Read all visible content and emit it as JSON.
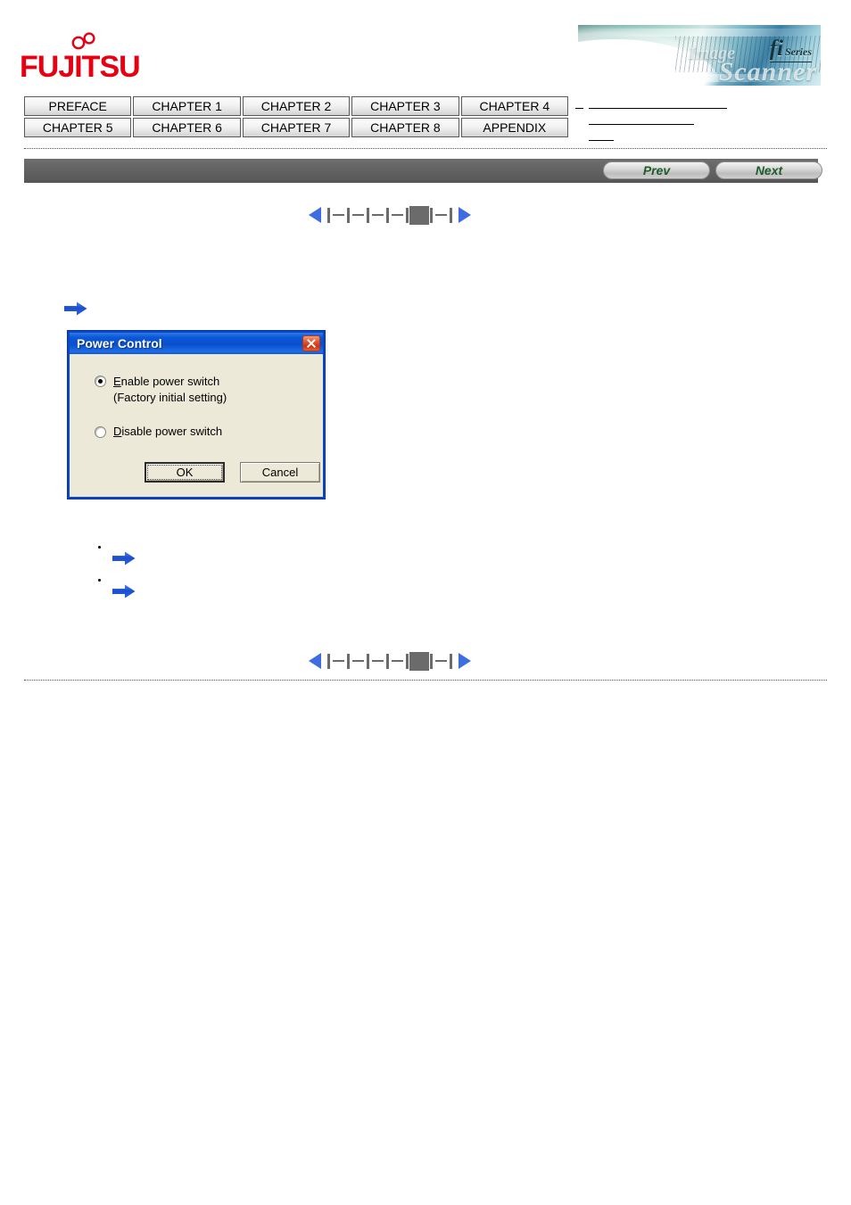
{
  "header": {
    "logo_text": "FUJITSU",
    "logo_color": "#e60012",
    "banner": {
      "product_line": "fi",
      "series_label": "Series",
      "tagline_primary": "Image",
      "tagline_secondary": "Scanner"
    }
  },
  "chapter_nav": {
    "row1": [
      "PREFACE",
      "CHAPTER 1",
      "CHAPTER 2",
      "CHAPTER 3",
      "CHAPTER 4"
    ],
    "row2": [
      "CHAPTER 5",
      "CHAPTER 6",
      "CHAPTER 7",
      "CHAPTER 8",
      "APPENDIX"
    ]
  },
  "toolbar": {
    "prev_label": "Prev",
    "next_label": "Next",
    "bar_color": "#616161",
    "button_text_color": "#1d5c2a"
  },
  "page_indicator": {
    "prev_icon": "triangle-left-icon",
    "next_icon": "triangle-right-icon",
    "total_ticks": 7,
    "current_tick": 5,
    "accent_color": "#3d6de0",
    "tick_color": "#6b6b6b"
  },
  "dialog": {
    "title": "Power Control",
    "close_icon": "close-icon",
    "titlebar_color": "#0b4fcd",
    "body_color": "#ece9d8",
    "options": [
      {
        "label": "Enable power switch",
        "accelerator": "E",
        "sublabel": "(Factory initial setting)",
        "sublabel_accelerator": "g",
        "selected": true
      },
      {
        "label": "Disable power switch",
        "accelerator": "D",
        "sublabel": "",
        "selected": false
      }
    ],
    "buttons": {
      "ok_label": "OK",
      "cancel_label": "Cancel",
      "default_button": "OK"
    }
  },
  "content": {
    "intro_arrow_icon": "blue-arrow-icon",
    "bullets": [
      {
        "marker": "bullet-dot",
        "arrow_icon": "blue-arrow-icon"
      },
      {
        "marker": "bullet-dot",
        "arrow_icon": "blue-arrow-icon"
      }
    ]
  },
  "breadcrumb": {
    "lines": 3
  }
}
